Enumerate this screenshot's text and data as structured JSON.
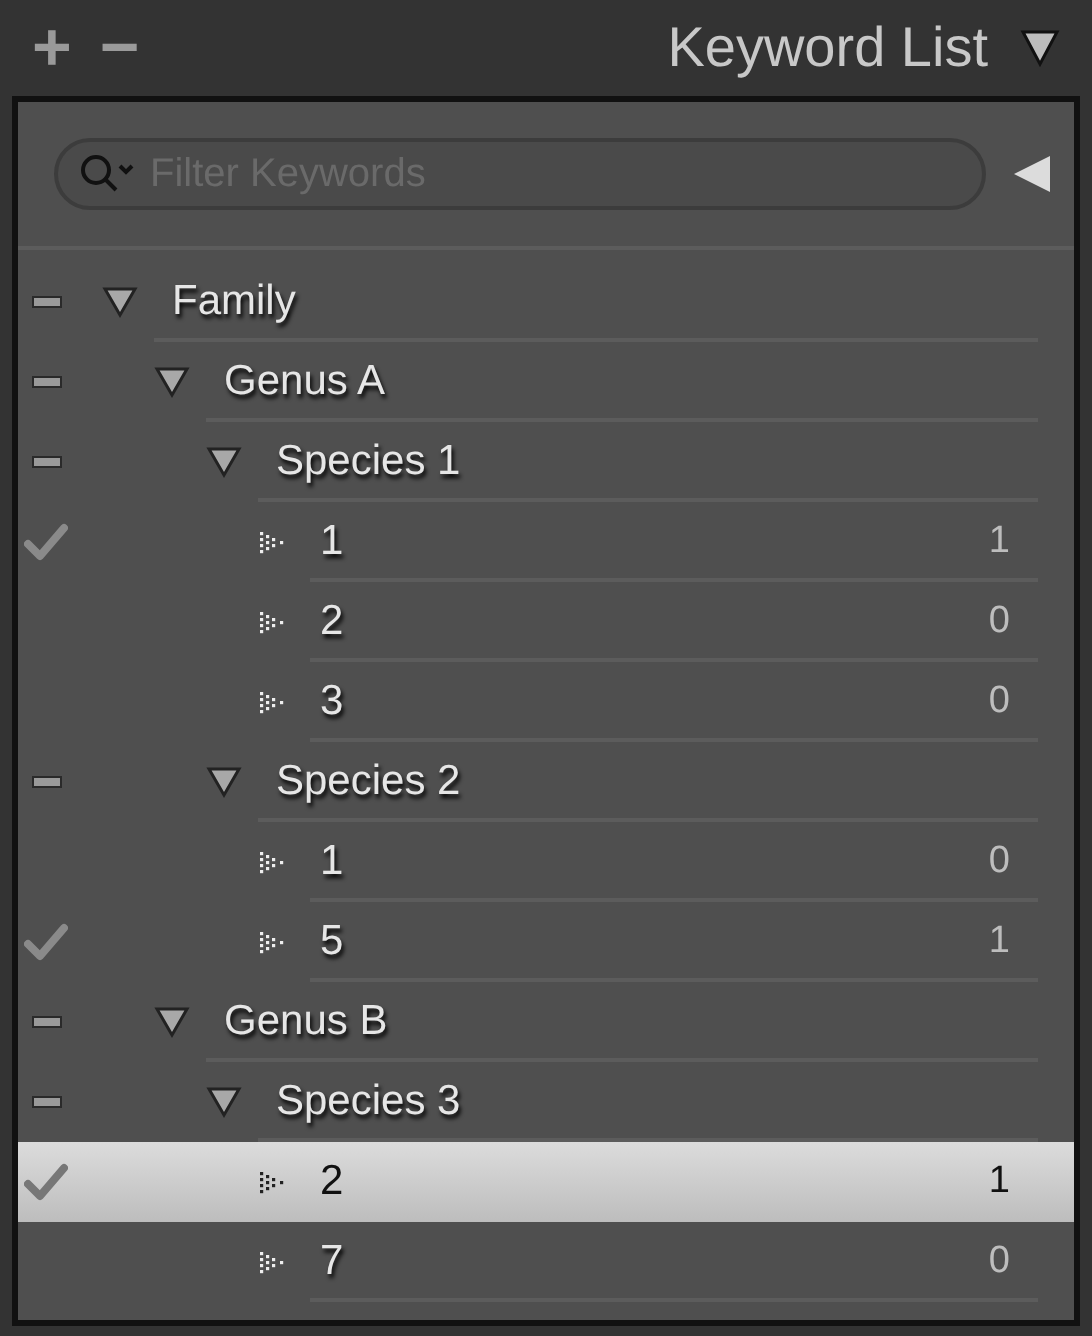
{
  "header": {
    "title": "Keyword List",
    "add": "+",
    "remove": "−"
  },
  "filter": {
    "placeholder": "Filter Keywords"
  },
  "tree": [
    {
      "label": "Family",
      "expanded": true,
      "partial": true,
      "selected": false,
      "children": [
        {
          "label": "Genus A",
          "expanded": true,
          "partial": true,
          "selected": false,
          "children": [
            {
              "label": "Species 1",
              "expanded": true,
              "partial": true,
              "selected": false,
              "children": [
                {
                  "label": "1",
                  "count": "1",
                  "checked": true,
                  "selected": false
                },
                {
                  "label": "2",
                  "count": "0",
                  "checked": false,
                  "selected": false
                },
                {
                  "label": "3",
                  "count": "0",
                  "checked": false,
                  "selected": false
                }
              ]
            },
            {
              "label": "Species 2",
              "expanded": true,
              "partial": true,
              "selected": false,
              "children": [
                {
                  "label": "1",
                  "count": "0",
                  "checked": false,
                  "selected": false
                },
                {
                  "label": "5",
                  "count": "1",
                  "checked": true,
                  "selected": false
                }
              ]
            }
          ]
        },
        {
          "label": "Genus B",
          "expanded": true,
          "partial": true,
          "selected": false,
          "children": [
            {
              "label": "Species 3",
              "expanded": true,
              "partial": true,
              "selected": false,
              "children": [
                {
                  "label": "2",
                  "count": "1",
                  "checked": true,
                  "selected": true
                },
                {
                  "label": "7",
                  "count": "0",
                  "checked": false,
                  "selected": false
                }
              ]
            }
          ]
        }
      ]
    }
  ]
}
